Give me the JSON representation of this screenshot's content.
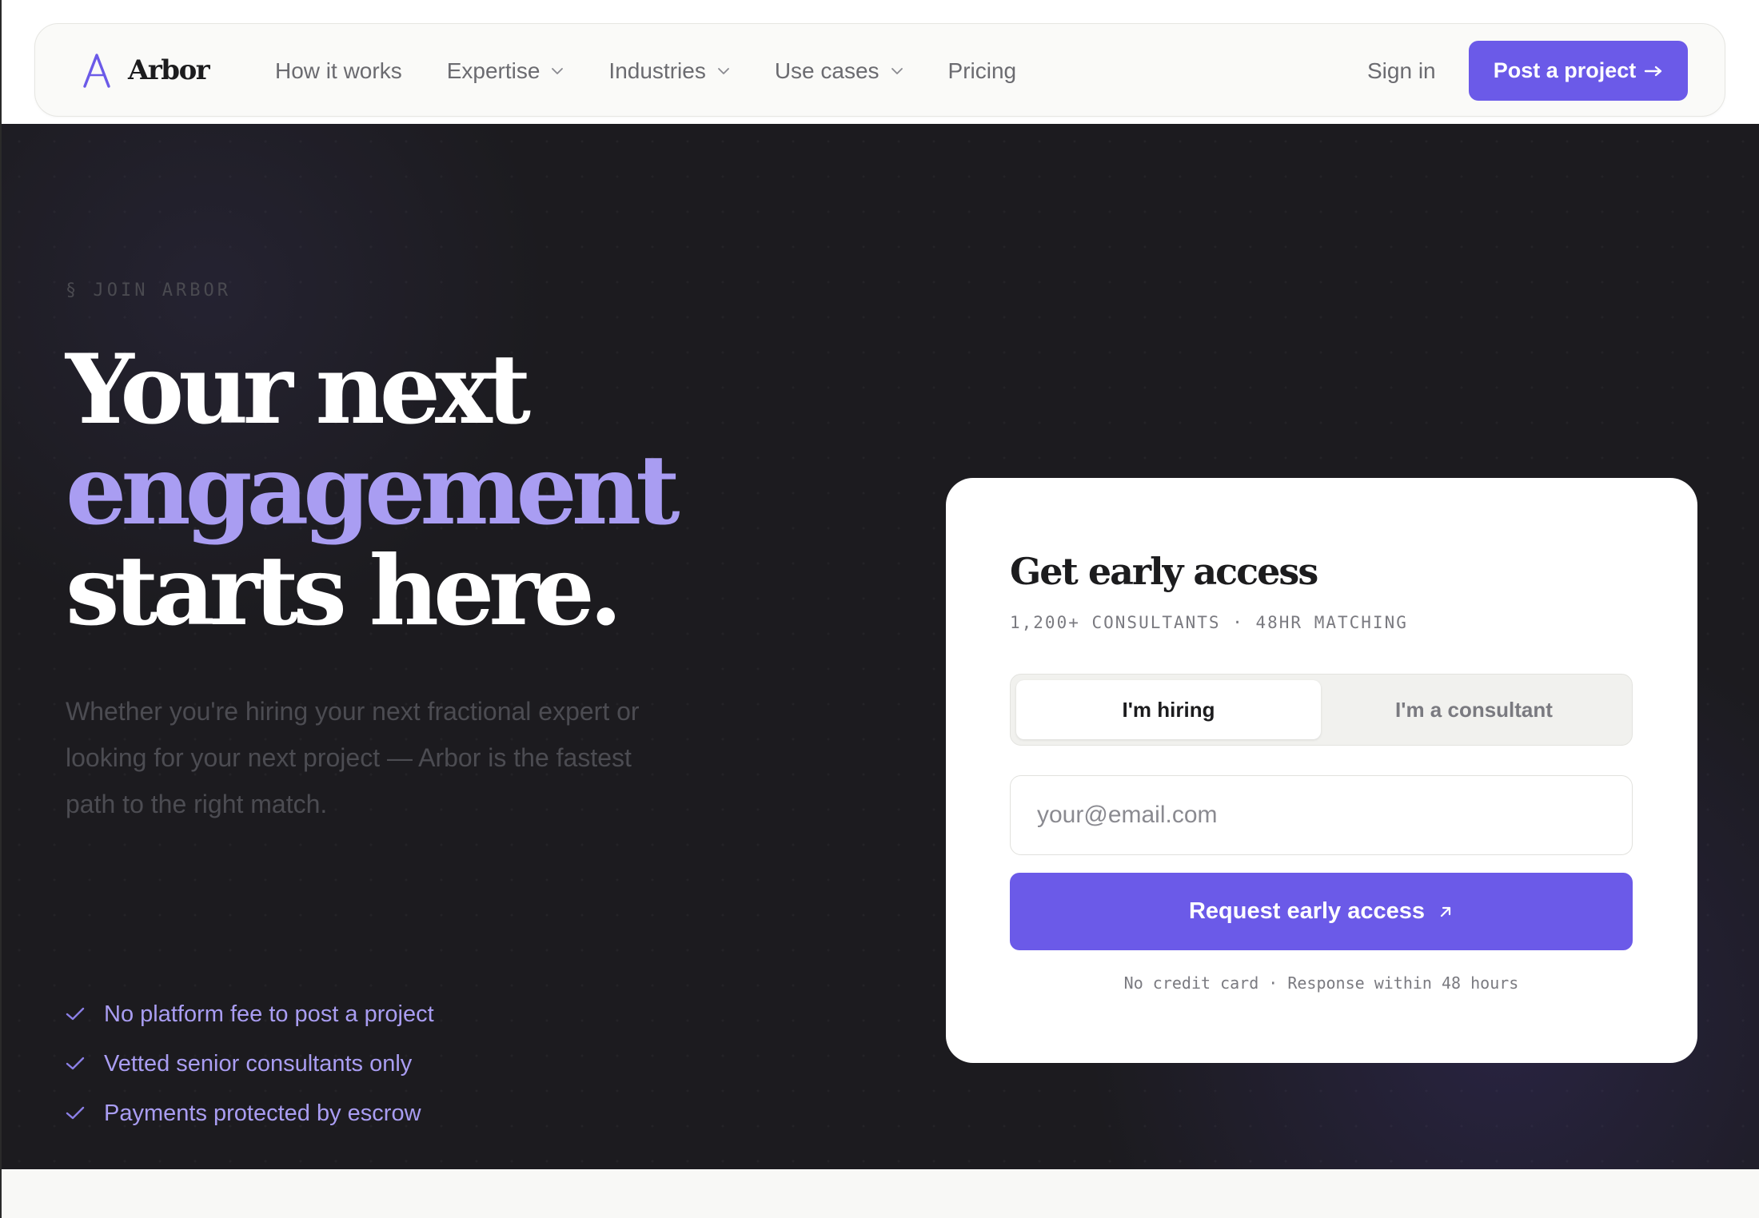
{
  "nav": {
    "brand": "Arbor",
    "links": [
      {
        "label": "How it works",
        "dropdown": false
      },
      {
        "label": "Expertise",
        "dropdown": true
      },
      {
        "label": "Industries",
        "dropdown": true
      },
      {
        "label": "Use cases",
        "dropdown": true
      },
      {
        "label": "Pricing",
        "dropdown": false
      }
    ],
    "sign_in": "Sign in",
    "cta": "Post a project",
    "cta_icon": "arrow-right-icon"
  },
  "hero": {
    "eyebrow": "§ JOIN ARBOR",
    "headline_line1": "Your next",
    "headline_line2": "engagement",
    "headline_line3": "starts here.",
    "subcopy": "Whether you're hiring your next fractional expert or looking for your next project — Arbor is the fastest path to the right match.",
    "checklist": [
      "No platform fee to post a project",
      "Vetted senior consultants only",
      "Payments protected by escrow"
    ]
  },
  "card": {
    "title": "Get early access",
    "subtitle": "1,200+ CONSULTANTS · 48HR MATCHING",
    "toggle": {
      "options": [
        "I'm hiring",
        "I'm a consultant"
      ],
      "selected": "I'm hiring"
    },
    "email_placeholder": "your@email.com",
    "email_value": "",
    "submit_label": "Request early access",
    "submit_icon": "arrow-up-right-icon",
    "fine_print": "No credit card · Response within 48 hours"
  },
  "colors": {
    "accent": "#6b5ae8",
    "accent_light": "#a99df2",
    "hero_bg": "#1c1b1f",
    "text_dark": "#1c1c1e"
  }
}
